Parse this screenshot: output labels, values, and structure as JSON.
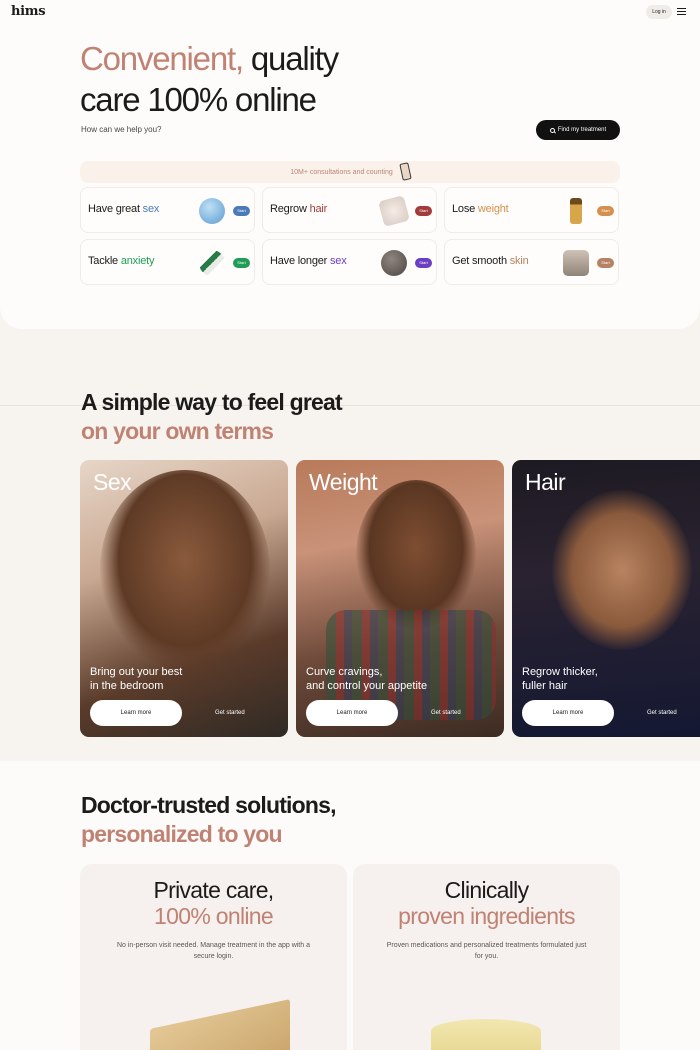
{
  "header": {
    "logo": "hims",
    "login_label": "Log in",
    "menu_icon": "menu-icon"
  },
  "hero": {
    "title_accent": "Convenient,",
    "title_rest": " quality",
    "title_line2": "care 100% online",
    "subtitle": "How can we help you?",
    "find_button": "Find my treatment",
    "consult_text": "10M+ consultations and counting"
  },
  "treatments": [
    {
      "label": "Have great ",
      "keyword": "sex",
      "color": "#4a7ab8",
      "start": "Start"
    },
    {
      "label": "Regrow ",
      "keyword": "hair",
      "color": "#a23b3b",
      "start": "Start"
    },
    {
      "label": "Lose ",
      "keyword": "weight",
      "color": "#d6904d",
      "start": "Start"
    },
    {
      "label": "Tackle ",
      "keyword": "anxiety",
      "color": "#1f9d55",
      "start": "Start"
    },
    {
      "label": "Have longer ",
      "keyword": "sex",
      "color": "#6b3fc1",
      "start": "Start"
    },
    {
      "label": "Get smooth ",
      "keyword": "skin",
      "color": "#b78263",
      "start": "Start"
    }
  ],
  "simple": {
    "title": "A simple way to feel great",
    "accent": "on your own terms",
    "cards": [
      {
        "title": "Sex",
        "desc_line1": "Bring out your best",
        "desc_line2": "in the bedroom",
        "learn": "Learn more",
        "get": "Get started"
      },
      {
        "title": "Weight",
        "desc_line1": "Curve cravings,",
        "desc_line2": "and control your appetite",
        "learn": "Learn more",
        "get": "Get started"
      },
      {
        "title": "Hair",
        "desc_line1": "Regrow thicker,",
        "desc_line2": "fuller hair",
        "learn": "Learn more",
        "get": "Get started"
      }
    ]
  },
  "doctor": {
    "title": "Doctor-trusted solutions,",
    "accent": "personalized to you",
    "cards": [
      {
        "title": "Private care,",
        "accent": "100% online",
        "desc": "No in-person visit needed. Manage treatment in the app with a secure login."
      },
      {
        "title": "Clinically",
        "accent": "proven ingredients",
        "desc": "Proven medications and personalized treatments formulated just for you."
      }
    ]
  },
  "colors": {
    "accent": "#c08272",
    "background": "#f7f4f0",
    "button_dark": "#111111"
  }
}
